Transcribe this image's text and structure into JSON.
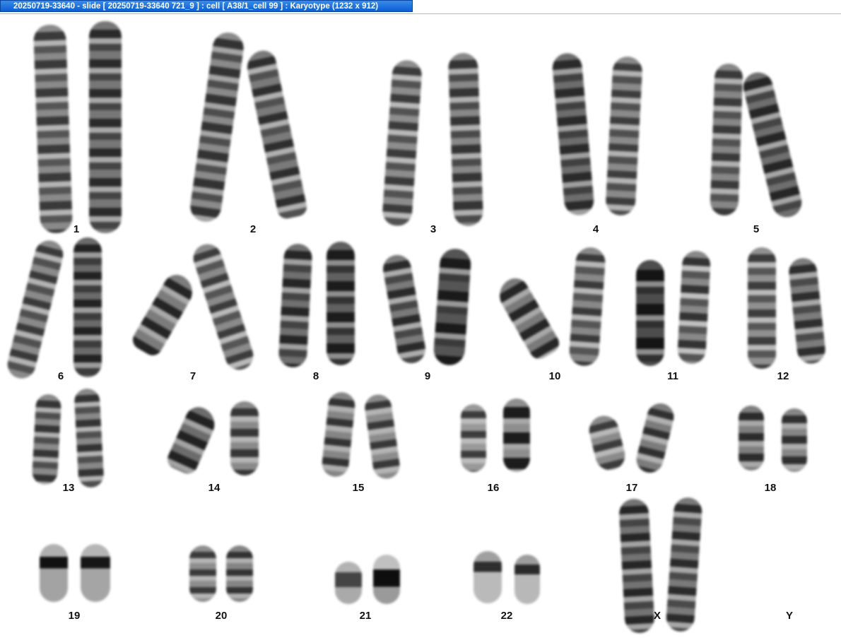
{
  "window": {
    "title": "20250719-33640 - slide [ 20250719-33640 721_9 ] : cell [ A38/1_cell 99 ] : Karyotype  (1232 x 912)"
  },
  "karyotype": {
    "labels": {
      "c1": "1",
      "c2": "2",
      "c3": "3",
      "c4": "4",
      "c5": "5",
      "c6": "6",
      "c7": "7",
      "c8": "8",
      "c9": "9",
      "c10": "10",
      "c11": "11",
      "c12": "12",
      "c13": "13",
      "c14": "14",
      "c15": "15",
      "c16": "16",
      "c17": "17",
      "c18": "18",
      "c19": "19",
      "c20": "20",
      "c21": "21",
      "c22": "22",
      "cX": "X",
      "cY": "Y"
    }
  }
}
